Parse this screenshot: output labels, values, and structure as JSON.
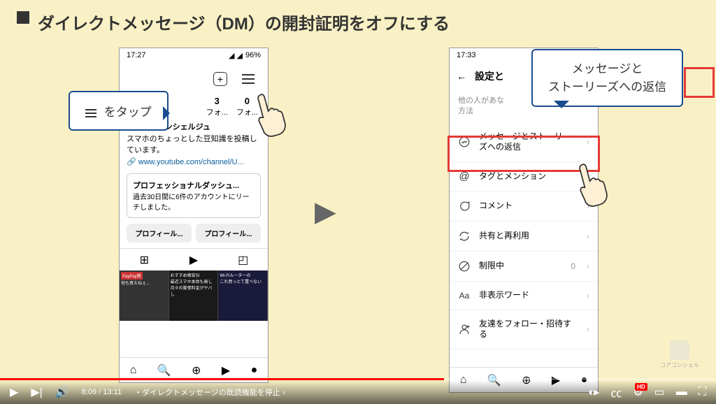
{
  "slide": {
    "title": "ダイレクトメッセージ（DM）の開封証明をオフにする"
  },
  "phone_left": {
    "time": "17:27",
    "battery": "96%",
    "stats": [
      {
        "num": "3",
        "label": "フォ..."
      },
      {
        "num": "0",
        "label": "フォ..."
      }
    ],
    "bio_title": "スマホのコンシェルジュ",
    "bio_text": "スマホのちょっとした豆知識を投稿しています。",
    "bio_link": "www.youtube.com/channel/U...",
    "dash_title": "プロフェッショナルダッシュ...",
    "dash_text": "過去30日間に6件のアカウントにリーチしました。",
    "btn1": "プロフィール...",
    "btn2": "プロフィール..."
  },
  "phone_right": {
    "time": "17:33",
    "header": "設定と",
    "sub": "他の人があな\n方法",
    "items": [
      {
        "label": "メッセージとストーリーズへの返信"
      },
      {
        "label": "タグとメンション"
      },
      {
        "label": "コメント"
      },
      {
        "label": "共有と再利用"
      },
      {
        "label": "制限中",
        "count": "0"
      },
      {
        "label": "非表示ワード"
      },
      {
        "label": "友達をフォロー・招待する"
      }
    ]
  },
  "callouts": {
    "c1": "をタップ",
    "c2_line1": "メッセージと",
    "c2_line2": "ストーリーズへの返信"
  },
  "player": {
    "current": "8:09",
    "total": "13:11",
    "chapter": "・ダイレクトメッセージの既読機能を停止",
    "hd": "HD"
  },
  "logo": "コアコンシェル"
}
